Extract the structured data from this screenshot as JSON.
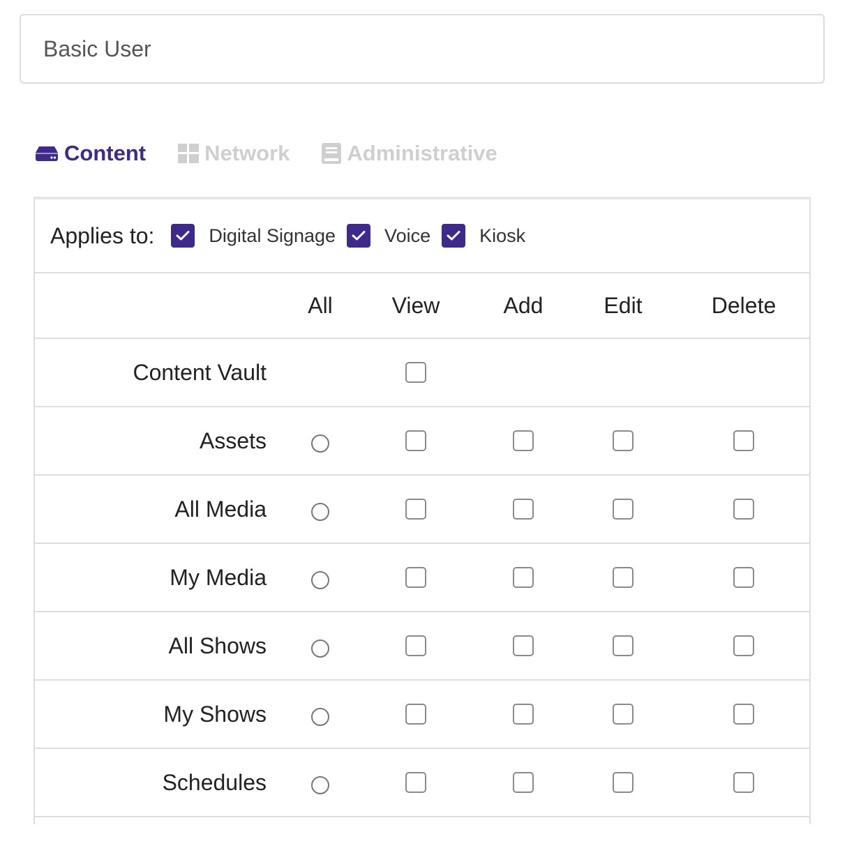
{
  "role": {
    "name_value": "Basic User"
  },
  "tabs": [
    {
      "label": "Content",
      "icon": "hard-drive-icon",
      "active": true
    },
    {
      "label": "Network",
      "icon": "grid-icon",
      "active": false
    },
    {
      "label": "Administrative",
      "icon": "book-icon",
      "active": false
    }
  ],
  "applies_to": {
    "label": "Applies to:",
    "options": [
      {
        "label": "Digital Signage",
        "checked": true
      },
      {
        "label": "Voice",
        "checked": true
      },
      {
        "label": "Kiosk",
        "checked": true
      }
    ]
  },
  "table": {
    "columns": [
      "All",
      "View",
      "Add",
      "Edit",
      "Delete"
    ],
    "rows": [
      {
        "label": "Content Vault",
        "all": false,
        "view": false,
        "add": null,
        "edit": null,
        "delete": null
      },
      {
        "label": "Assets",
        "all": false,
        "view": false,
        "add": false,
        "edit": false,
        "delete": false
      },
      {
        "label": "All Media",
        "all": false,
        "view": false,
        "add": false,
        "edit": false,
        "delete": false
      },
      {
        "label": "My Media",
        "all": false,
        "view": false,
        "add": false,
        "edit": false,
        "delete": false
      },
      {
        "label": "All Shows",
        "all": false,
        "view": false,
        "add": false,
        "edit": false,
        "delete": false
      },
      {
        "label": "My Shows",
        "all": false,
        "view": false,
        "add": false,
        "edit": false,
        "delete": false
      },
      {
        "label": "Schedules",
        "all": false,
        "view": false,
        "add": false,
        "edit": false,
        "delete": false
      }
    ]
  },
  "colors": {
    "accent": "#3f2a8c",
    "inactive_tab": "#cfcfcf",
    "border": "#dedede"
  }
}
